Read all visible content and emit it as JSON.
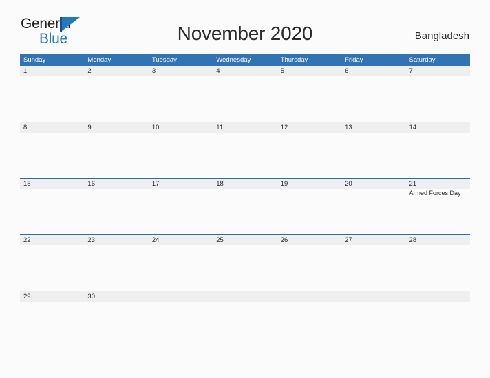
{
  "brand": {
    "word_general": "General",
    "word_blue": "Blue",
    "flag_icon": "blue-flag-icon",
    "accent_color": "#1f7ac4"
  },
  "header": {
    "title": "November 2020",
    "country": "Bangladesh"
  },
  "theme": {
    "header_blue": "#3074b5",
    "row_line_blue": "#2e6da4",
    "band_gray": "#efefef",
    "page_background": "#fbfbfb",
    "text_dark": "#2b2b2b"
  },
  "calendar": {
    "weekdays": [
      "Sunday",
      "Monday",
      "Tuesday",
      "Wednesday",
      "Thursday",
      "Friday",
      "Saturday"
    ],
    "weeks": [
      {
        "short": false,
        "days": [
          {
            "number": "1",
            "events": []
          },
          {
            "number": "2",
            "events": []
          },
          {
            "number": "3",
            "events": []
          },
          {
            "number": "4",
            "events": []
          },
          {
            "number": "5",
            "events": []
          },
          {
            "number": "6",
            "events": []
          },
          {
            "number": "7",
            "events": []
          }
        ]
      },
      {
        "short": false,
        "days": [
          {
            "number": "8",
            "events": []
          },
          {
            "number": "9",
            "events": []
          },
          {
            "number": "10",
            "events": []
          },
          {
            "number": "11",
            "events": []
          },
          {
            "number": "12",
            "events": []
          },
          {
            "number": "13",
            "events": []
          },
          {
            "number": "14",
            "events": []
          }
        ]
      },
      {
        "short": false,
        "days": [
          {
            "number": "15",
            "events": []
          },
          {
            "number": "16",
            "events": []
          },
          {
            "number": "17",
            "events": []
          },
          {
            "number": "18",
            "events": []
          },
          {
            "number": "19",
            "events": []
          },
          {
            "number": "20",
            "events": []
          },
          {
            "number": "21",
            "events": [
              "Armed Forces Day"
            ]
          }
        ]
      },
      {
        "short": false,
        "days": [
          {
            "number": "22",
            "events": []
          },
          {
            "number": "23",
            "events": []
          },
          {
            "number": "24",
            "events": []
          },
          {
            "number": "25",
            "events": []
          },
          {
            "number": "26",
            "events": []
          },
          {
            "number": "27",
            "events": []
          },
          {
            "number": "28",
            "events": []
          }
        ]
      },
      {
        "short": true,
        "days": [
          {
            "number": "29",
            "events": []
          },
          {
            "number": "30",
            "events": []
          },
          {
            "number": "",
            "events": []
          },
          {
            "number": "",
            "events": []
          },
          {
            "number": "",
            "events": []
          },
          {
            "number": "",
            "events": []
          },
          {
            "number": "",
            "events": []
          }
        ]
      }
    ]
  }
}
